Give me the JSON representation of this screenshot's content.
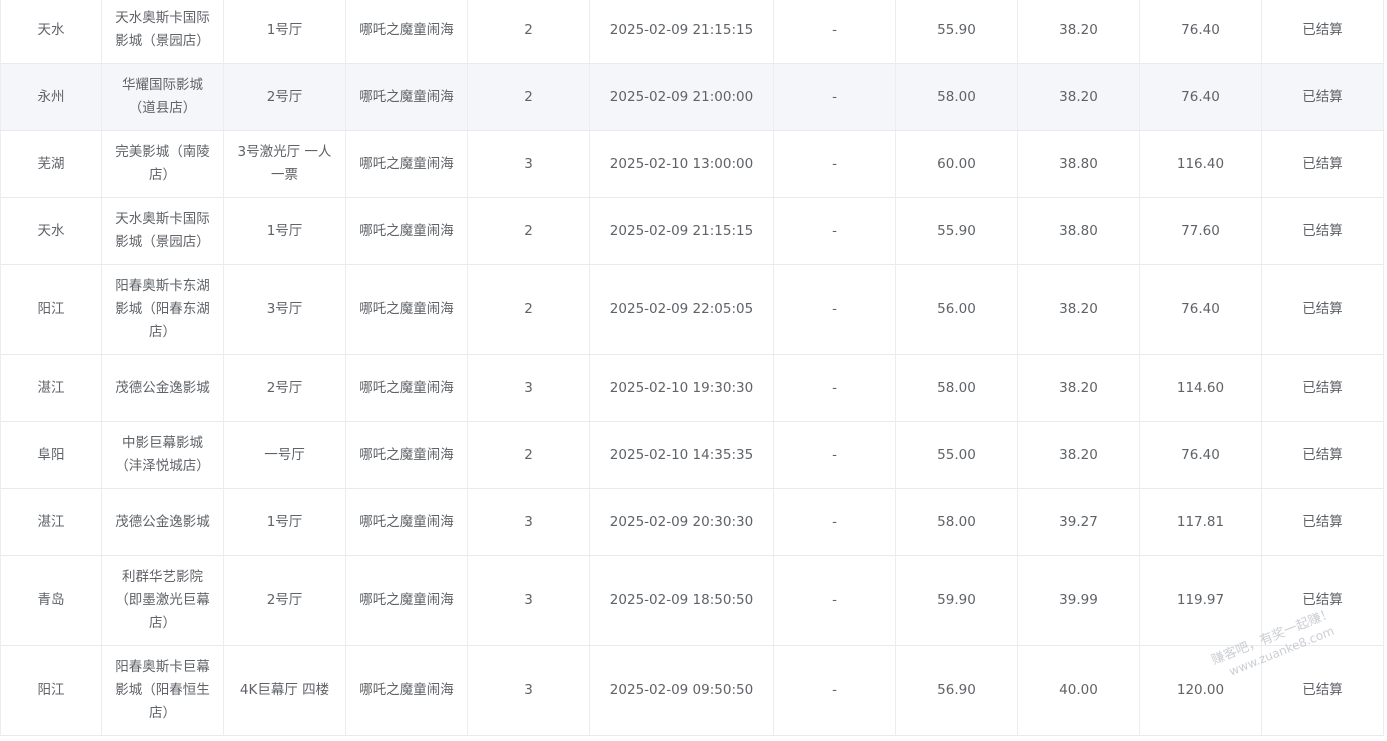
{
  "rows": [
    {
      "city": "天水",
      "cinema": "天水奥斯卡国际影城（景园店）",
      "hall": "1号厅",
      "movie": "哪吒之魔童闹海",
      "qty": "2",
      "showtime": "2025-02-09 21:15:15",
      "seat": "-",
      "price": "55.90",
      "unit_cost": "38.20",
      "total": "76.40",
      "status": "已结算"
    },
    {
      "city": "永州",
      "cinema": "华耀国际影城（道县店）",
      "hall": "2号厅",
      "movie": "哪吒之魔童闹海",
      "qty": "2",
      "showtime": "2025-02-09 21:00:00",
      "seat": "-",
      "price": "58.00",
      "unit_cost": "38.20",
      "total": "76.40",
      "status": "已结算"
    },
    {
      "city": "芜湖",
      "cinema": "完美影城（南陵店）",
      "hall": "3号激光厅 一人一票",
      "movie": "哪吒之魔童闹海",
      "qty": "3",
      "showtime": "2025-02-10 13:00:00",
      "seat": "-",
      "price": "60.00",
      "unit_cost": "38.80",
      "total": "116.40",
      "status": "已结算"
    },
    {
      "city": "天水",
      "cinema": "天水奥斯卡国际影城（景园店）",
      "hall": "1号厅",
      "movie": "哪吒之魔童闹海",
      "qty": "2",
      "showtime": "2025-02-09 21:15:15",
      "seat": "-",
      "price": "55.90",
      "unit_cost": "38.80",
      "total": "77.60",
      "status": "已结算"
    },
    {
      "city": "阳江",
      "cinema": "阳春奥斯卡东湖影城（阳春东湖店）",
      "hall": "3号厅",
      "movie": "哪吒之魔童闹海",
      "qty": "2",
      "showtime": "2025-02-09 22:05:05",
      "seat": "-",
      "price": "56.00",
      "unit_cost": "38.20",
      "total": "76.40",
      "status": "已结算"
    },
    {
      "city": "湛江",
      "cinema": "茂德公金逸影城",
      "hall": "2号厅",
      "movie": "哪吒之魔童闹海",
      "qty": "3",
      "showtime": "2025-02-10 19:30:30",
      "seat": "-",
      "price": "58.00",
      "unit_cost": "38.20",
      "total": "114.60",
      "status": "已结算"
    },
    {
      "city": "阜阳",
      "cinema": "中影巨幕影城（沣泽悦城店）",
      "hall": "一号厅",
      "movie": "哪吒之魔童闹海",
      "qty": "2",
      "showtime": "2025-02-10 14:35:35",
      "seat": "-",
      "price": "55.00",
      "unit_cost": "38.20",
      "total": "76.40",
      "status": "已结算"
    },
    {
      "city": "湛江",
      "cinema": "茂德公金逸影城",
      "hall": "1号厅",
      "movie": "哪吒之魔童闹海",
      "qty": "3",
      "showtime": "2025-02-09 20:30:30",
      "seat": "-",
      "price": "58.00",
      "unit_cost": "39.27",
      "total": "117.81",
      "status": "已结算"
    },
    {
      "city": "青岛",
      "cinema": "利群华艺影院（即墨激光巨幕店）",
      "hall": "2号厅",
      "movie": "哪吒之魔童闹海",
      "qty": "3",
      "showtime": "2025-02-09 18:50:50",
      "seat": "-",
      "price": "59.90",
      "unit_cost": "39.99",
      "total": "119.97",
      "status": "已结算"
    },
    {
      "city": "阳江",
      "cinema": "阳春奥斯卡巨幕影城（阳春恒生店）",
      "hall": "4K巨幕厅 四楼",
      "movie": "哪吒之魔童闹海",
      "qty": "3",
      "showtime": "2025-02-09 09:50:50",
      "seat": "-",
      "price": "56.90",
      "unit_cost": "40.00",
      "total": "120.00",
      "status": "已结算"
    }
  ],
  "watermark": {
    "line1": "赚客吧，有奖一起赚！",
    "line2": "www.zuanke8.com"
  }
}
